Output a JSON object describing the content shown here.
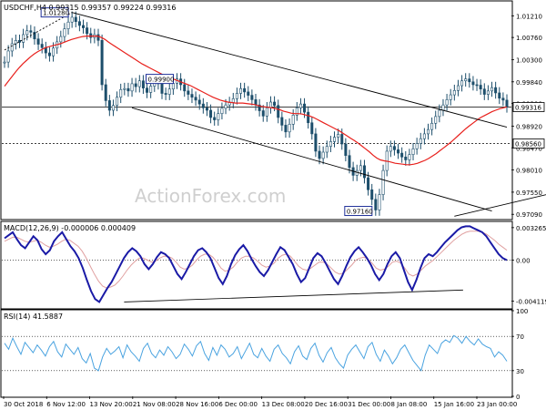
{
  "chart_data": [
    {
      "type": "candlestick",
      "title": "USDCHF,H4  0.99315 0.99357 0.99224 0.99316",
      "ylim": [
        0.97,
        1.015
      ],
      "yticks": [
        "1.01210",
        "1.00760",
        "1.00300",
        "0.99840",
        "0.99390",
        "0.98920",
        "0.98470",
        "0.98010",
        "0.97550",
        "0.97090"
      ],
      "price_labels": [
        {
          "text": "0.99316",
          "value": 0.99316
        },
        {
          "text": "0.98560",
          "value": 0.9856
        }
      ],
      "annotations": [
        {
          "text": "1.01280",
          "value": 1.0128
        },
        {
          "text": "0.99900",
          "value": 0.999
        },
        {
          "text": "0.97160",
          "value": 0.9716
        }
      ],
      "watermark": "ActionForex.com",
      "colors": {
        "price": "#1c4e6b",
        "moving_average": "#e8201c",
        "trendline": "#000000",
        "label_border": "#1e2f99"
      },
      "close_series": [
        1.0025,
        1.0048,
        1.0063,
        1.007,
        1.0066,
        1.0082,
        1.009,
        1.0087,
        1.0073,
        1.0062,
        1.0055,
        1.0044,
        1.0038,
        1.0054,
        1.0067,
        1.0078,
        1.0094,
        1.0108,
        1.0118,
        1.0109,
        1.0101,
        1.0096,
        1.0084,
        1.0076,
        1.0082,
        1.007,
        0.9978,
        0.9945,
        0.9925,
        0.9935,
        0.9952,
        0.9968,
        0.997,
        0.9965,
        0.998,
        0.9974,
        0.9986,
        0.9971,
        0.9962,
        0.9975,
        0.9986,
        0.998,
        0.996,
        0.9958,
        0.9969,
        0.9981,
        0.999,
        0.9978,
        0.9965,
        0.9958,
        0.9952,
        0.9946,
        0.9938,
        0.993,
        0.9925,
        0.991,
        0.9905,
        0.9918,
        0.9929,
        0.9936,
        0.9941,
        0.9949,
        0.996,
        0.997,
        0.9963,
        0.9956,
        0.9947,
        0.9936,
        0.9924,
        0.9913,
        0.993,
        0.9942,
        0.9935,
        0.991,
        0.9894,
        0.988,
        0.9896,
        0.9915,
        0.993,
        0.9938,
        0.9921,
        0.9899,
        0.9876,
        0.984,
        0.9825,
        0.9838,
        0.985,
        0.986,
        0.9869,
        0.9875,
        0.9855,
        0.9831,
        0.9806,
        0.979,
        0.98,
        0.981,
        0.9785,
        0.976,
        0.974,
        0.9718,
        0.975,
        0.98,
        0.984,
        0.985,
        0.9843,
        0.9836,
        0.9828,
        0.9822,
        0.9833,
        0.9845,
        0.9856,
        0.9866,
        0.9876,
        0.9885,
        0.9898,
        0.9912,
        0.9925,
        0.9936,
        0.9947,
        0.9957,
        0.9966,
        0.9976,
        0.9986,
        0.999,
        0.9984,
        0.9978,
        0.9977,
        0.9969,
        0.9958,
        0.9965,
        0.9972,
        0.9961,
        0.995,
        0.9946,
        0.9932
      ],
      "ma_series": [
        0.9975,
        0.9985,
        0.9995,
        1.0005,
        1.0014,
        1.0022,
        1.0029,
        1.0036,
        1.0042,
        1.0047,
        1.0051,
        1.0055,
        1.0057,
        1.0059,
        1.0061,
        1.0063,
        1.0066,
        1.0069,
        1.0072,
        1.0074,
        1.0076,
        1.0078,
        1.0079,
        1.0079,
        1.0079,
        1.0079,
        1.0076,
        1.0072,
        1.0066,
        1.0061,
        1.0056,
        1.0051,
        1.0046,
        1.0041,
        1.0036,
        1.0031,
        1.0026,
        1.0021,
        1.0017,
        1.0013,
        1.0009,
        1.0005,
        1.0001,
        0.9997,
        0.9994,
        0.9991,
        0.9988,
        0.9985,
        0.9982,
        0.9979,
        0.9976,
        0.9972,
        0.9968,
        0.9964,
        0.996,
        0.9956,
        0.9952,
        0.9949,
        0.9946,
        0.9944,
        0.9942,
        0.9941,
        0.994,
        0.994,
        0.994,
        0.9939,
        0.9938,
        0.9937,
        0.9935,
        0.9933,
        0.9932,
        0.9931,
        0.993,
        0.9928,
        0.9926,
        0.9923,
        0.9921,
        0.9919,
        0.9918,
        0.9918,
        0.9917,
        0.9915,
        0.9913,
        0.991,
        0.9906,
        0.9902,
        0.9898,
        0.9894,
        0.989,
        0.9886,
        0.9882,
        0.9877,
        0.9872,
        0.9867,
        0.9862,
        0.9857,
        0.9851,
        0.9845,
        0.9839,
        0.9832,
        0.9826,
        0.9822,
        0.982,
        0.9819,
        0.9817,
        0.9815,
        0.9814,
        0.9813,
        0.9812,
        0.9812,
        0.9813,
        0.9815,
        0.9818,
        0.9821,
        0.9825,
        0.983,
        0.9835,
        0.9841,
        0.9847,
        0.9853,
        0.9859,
        0.9866,
        0.9873,
        0.988,
        0.9887,
        0.9893,
        0.9899,
        0.9905,
        0.991,
        0.9914,
        0.9918,
        0.9922,
        0.9925,
        0.9928,
        0.993,
        0.9932
      ],
      "trendlines": [
        {
          "name": "channel-upper",
          "points": [
            [
              18,
              1.0128
            ],
            [
              134,
              0.989
            ]
          ]
        },
        {
          "name": "channel-lower",
          "points": [
            [
              34,
              0.993
            ],
            [
              130,
              0.9716
            ]
          ]
        },
        {
          "name": "support-line",
          "points": [
            [
              120,
              0.9705
            ],
            [
              150,
              0.976
            ]
          ]
        },
        {
          "name": "dotted-top",
          "points": [
            [
              0,
              1.005
            ],
            [
              18,
              1.0128
            ]
          ]
        }
      ]
    },
    {
      "type": "line",
      "title": "MACD(12,26,9) -0.000006 0.000409",
      "ylim": [
        -0.0048,
        0.0038
      ],
      "yticks": [
        "0.003265",
        "0.00",
        "-0.004119"
      ],
      "series": [
        {
          "name": "",
          "values": [
            0.0022,
            0.0025,
            0.0028,
            0.0021,
            0.0015,
            0.0012,
            0.0018,
            0.0024,
            0.002,
            0.0011,
            0.0006,
            0.001,
            0.0019,
            0.0024,
            0.0028,
            0.0021,
            0.0014,
            0.0009,
            0.0002,
            -0.0008,
            -0.002,
            -0.0031,
            -0.0039,
            -0.0042,
            -0.0035,
            -0.0028,
            -0.0022,
            -0.0014,
            -0.0006,
            0.0002,
            0.0008,
            0.0012,
            0.0009,
            0.0004,
            -0.0004,
            -0.0009,
            -0.0004,
            0.0003,
            0.0008,
            0.0006,
            0.0002,
            -0.0006,
            -0.0014,
            -0.0019,
            -0.0012,
            -0.0004,
            0.0004,
            0.001,
            0.0012,
            0.0008,
            0.0002,
            -0.0008,
            -0.0018,
            -0.0024,
            -0.0016,
            -0.0004,
            0.0005,
            0.0011,
            0.0015,
            0.0009,
            0.0001,
            -0.0006,
            -0.0012,
            -0.0016,
            -0.001,
            -0.0002,
            0.0006,
            0.0013,
            0.001,
            0.0003,
            -0.0004,
            -0.0014,
            -0.0022,
            -0.0018,
            -0.0008,
            0.0002,
            0.0007,
            0.0004,
            -0.0003,
            -0.0011,
            -0.0019,
            -0.0024,
            -0.0016,
            -0.0006,
            0.0003,
            0.0009,
            0.0013,
            0.0008,
            0.0002,
            -0.0005,
            -0.0014,
            -0.002,
            -0.0014,
            -0.0004,
            0.0004,
            0.0008,
            0.0002,
            -0.001,
            -0.0022,
            -0.003,
            -0.002,
            -0.0008,
            0.0002,
            0.0006,
            0.0004,
            0.0008,
            0.0013,
            0.0018,
            0.0022,
            0.0026,
            0.003,
            0.0033,
            0.0034,
            0.0034,
            0.0032,
            0.003,
            0.0028,
            0.0024,
            0.0018,
            0.0012,
            0.0006,
            0.0002,
            0.0
          ]
        },
        {
          "name": "",
          "values": [
            0.0019,
            0.0021,
            0.0023,
            0.0023,
            0.0021,
            0.0019,
            0.0018,
            0.0019,
            0.002,
            0.0018,
            0.0015,
            0.0013,
            0.0014,
            0.0016,
            0.0019,
            0.0021,
            0.002,
            0.0017,
            0.0014,
            0.0009,
            0.0002,
            -0.0006,
            -0.0014,
            -0.0021,
            -0.0026,
            -0.0028,
            -0.0027,
            -0.0025,
            -0.0021,
            -0.0016,
            -0.001,
            -0.0005,
            -0.0001,
            0.0002,
            0.0002,
            0.0,
            -0.0002,
            -0.0001,
            0.0002,
            0.0004,
            0.0004,
            0.0002,
            -0.0002,
            -0.0007,
            -0.0009,
            -0.0008,
            -0.0005,
            0.0,
            0.0004,
            0.0006,
            0.0006,
            0.0003,
            -0.0002,
            -0.0008,
            -0.0011,
            -0.001,
            -0.0007,
            -0.0002,
            0.0002,
            0.0004,
            0.0004,
            0.0002,
            -0.0001,
            -0.0005,
            -0.0007,
            -0.0006,
            -0.0003,
            0.0002,
            0.0005,
            0.0006,
            0.0004,
            -0.0001,
            -0.0006,
            -0.0009,
            -0.001,
            -0.0008,
            -0.0005,
            -0.0002,
            -0.0002,
            -0.0004,
            -0.0008,
            -0.0012,
            -0.0014,
            -0.0013,
            -0.0009,
            -0.0005,
            0.0,
            0.0002,
            0.0003,
            0.0001,
            -0.0003,
            -0.0008,
            -0.001,
            -0.0009,
            -0.0006,
            -0.0002,
            -0.0001,
            -0.0003,
            -0.0008,
            -0.0014,
            -0.0016,
            -0.0014,
            -0.001,
            -0.0006,
            -0.0003,
            0.0,
            0.0004,
            0.0008,
            0.0012,
            0.0016,
            0.002,
            0.0023,
            0.0026,
            0.0028,
            0.0029,
            0.0029,
            0.0029,
            0.0028,
            0.0026,
            0.0023,
            0.002,
            0.0016,
            0.0013,
            0.001
          ]
        }
      ],
      "colors": {
        "main": "#1a1aa6",
        "signal": "#e0a0a0"
      },
      "trendlines": [
        {
          "name": "macd-support",
          "points": [
            [
              0.24,
              -0.0042
            ],
            [
              0.905,
              -0.003
            ]
          ]
        }
      ]
    },
    {
      "type": "line",
      "title": "RSI(14) 41.5887",
      "ylim": [
        0,
        100
      ],
      "yticks": [
        "100",
        "70",
        "30",
        "0"
      ],
      "levels": [
        70,
        30
      ],
      "series": [
        {
          "name": "",
          "values": [
            62,
            55,
            68,
            58,
            49,
            63,
            57,
            51,
            60,
            54,
            47,
            58,
            64,
            52,
            46,
            61,
            55,
            49,
            57,
            44,
            39,
            50,
            33,
            30,
            46,
            56,
            49,
            53,
            58,
            45,
            60,
            52,
            47,
            41,
            56,
            62,
            50,
            45,
            54,
            48,
            58,
            52,
            44,
            49,
            61,
            55,
            47,
            59,
            64,
            50,
            42,
            57,
            48,
            60,
            55,
            46,
            50,
            58,
            44,
            53,
            62,
            49,
            45,
            56,
            47,
            41,
            55,
            60,
            50,
            45,
            38,
            52,
            59,
            47,
            43,
            56,
            62,
            48,
            40,
            51,
            57,
            45,
            38,
            33,
            48,
            55,
            60,
            52,
            44,
            58,
            63,
            49,
            41,
            54,
            47,
            38,
            45,
            55,
            60,
            51,
            42,
            36,
            30,
            48,
            60,
            55,
            50,
            62,
            66,
            63,
            71,
            68,
            62,
            70,
            64,
            60,
            67,
            61,
            58,
            56,
            46,
            52,
            48,
            41
          ]
        }
      ],
      "colors": {
        "main": "#4aa3e0"
      }
    }
  ],
  "x_axis": {
    "labels": [
      "30 Oct 2018",
      "6 Nov 12:00",
      "13 Nov 20:00",
      "21 Nov 08:00",
      "28 Nov 16:00",
      "6 Dec 00:00",
      "13 Dec 08:00",
      "20 Dec 16:00",
      "31 Dec 00:00",
      "8 Jan 08:00",
      "15 Jan 16:00",
      "23 Jan 00:00"
    ]
  }
}
